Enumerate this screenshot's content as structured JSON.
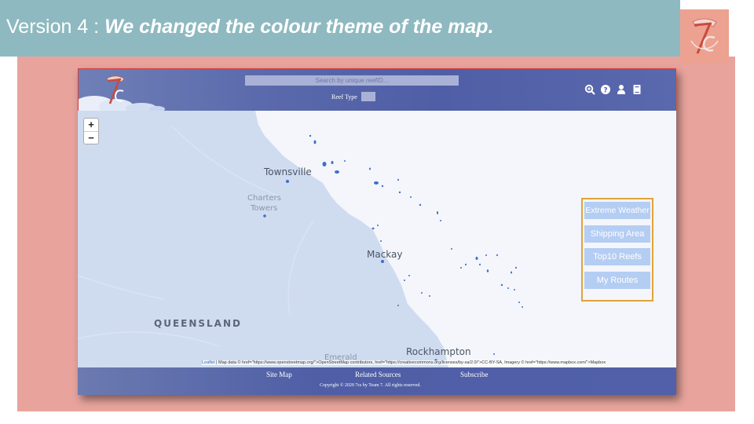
{
  "slide": {
    "title_prefix": "Version 4 : ",
    "title_emphasis": "We changed the colour theme of the map.",
    "colors": {
      "title_bar": "#8fb9c0",
      "background": "#e8a49c",
      "corner_logo": "#eda190"
    }
  },
  "header": {
    "search_placeholder": "Search by unique reefID...",
    "reef_type_label": "Reef Type",
    "icons": [
      "search-zoom-icon",
      "help-icon",
      "user-icon",
      "book-icon"
    ],
    "colors": {
      "bar": "#5b6aac",
      "border": "#d83d3d"
    }
  },
  "map": {
    "zoom_in": "+",
    "zoom_out": "−",
    "labels": {
      "townsville": "Townsville",
      "charters_towers_1": "Charters",
      "charters_towers_2": "Towers",
      "mackay": "Mackay",
      "queensland": "QUEENSLAND",
      "emerald": "Emerald",
      "rockhampton": "Rockhampton"
    },
    "attribution_leaflet": "Leaflet",
    "attribution_text": " | Map data © href=\"https://www.openstreetmap.org/\">OpenStreetMap contributors, href=\"https://creativecommons.org/licenses/by-sa/2.0/\">CC-BY-SA, Imagery © href=\"https://www.mapbox.com/\">Mapbox",
    "colors": {
      "land": "#cfdcf0",
      "sea": "#f4f6fb",
      "reef": "#3f6fc9"
    }
  },
  "panel": {
    "buttons": [
      "Extreme Weather",
      "Shipping Area",
      "Top10 Reefs",
      "My Routes"
    ],
    "colors": {
      "border": "#e0a33a",
      "button": "#b4cdf3"
    }
  },
  "footer": {
    "site_map": "Site Map",
    "related_sources": "Related Sources",
    "subscribe": "Subscribe",
    "copyright": "Copyright © 2020 7cs by Team 7. All rights reserved."
  }
}
